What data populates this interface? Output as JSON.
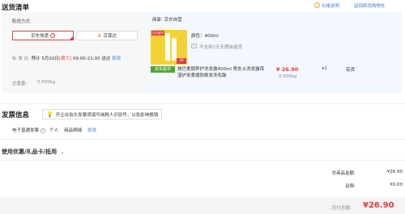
{
  "header": {
    "title": "送货清单",
    "price_note": "价格说明",
    "back_to_cart": "返回修改购物车"
  },
  "delivery": {
    "method_label": "配送方式",
    "option_jd": "京东快递",
    "option_jingzhun": "京尊达",
    "arrival_label": "标  准  达:",
    "arrival_value": "预计 5月10日",
    "arrival_weekday": "[周六]",
    "arrival_time": "09:00-21:00 送达",
    "modify": "修改",
    "total_weight_label": "总重量:",
    "total_weight_value": "0.500kg"
  },
  "shop": {
    "label": "商家:",
    "name": "京东自营"
  },
  "product": {
    "image_badge": "京东超市",
    "thumb_text": "26",
    "color_spec": "颜色：400ml",
    "no_return": "不支持7天无理由退货",
    "tag": "京东超市",
    "name": "施巴柔顺养护洗发露400ml 男女士洗发露保湿护发柔顺防断发洗毛躁",
    "price": "¥ 26.90",
    "weight": "0.500kg",
    "qty": "x1",
    "stock": "有货"
  },
  "invoice": {
    "title": "发票信息",
    "notice": "开企业抬头发票须填写纳税人识别号，以免影响报销",
    "type": "电子普通发票",
    "personal": "个人",
    "detail": "商品明细",
    "modify": "修改"
  },
  "coupon": {
    "title": "使用优惠/礼品卡/抵用"
  },
  "summary": {
    "total_label": "总商品金额:",
    "total_value": "¥26.90",
    "shipping_label": "运费:",
    "shipping_value": "¥0.00",
    "payable_label": "应付总额:",
    "payable_value": "¥26.90"
  }
}
